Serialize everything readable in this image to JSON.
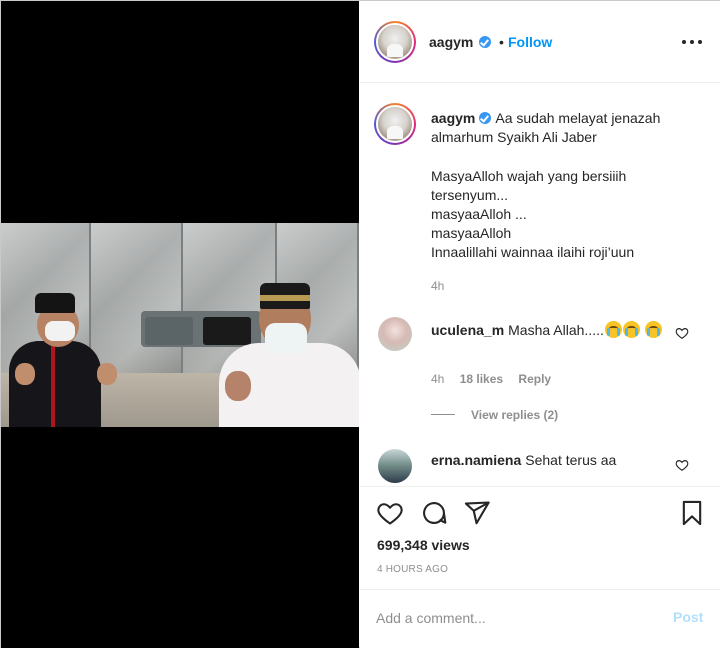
{
  "post": {
    "username": "aagym",
    "follow_label": "Follow",
    "dot": "•",
    "more_icon": "more-horizontal-icon"
  },
  "caption": {
    "username": "aagym",
    "first_line": "Aa sudah melayat jenazah almarhum Syaikh Ali Jaber",
    "body": "MasyaAlloh wajah yang bersiiih\ntersenyum...\nmasyaaAlloh ...\nmasyaaAlloh\nInnaalillahi wainnaa ilaihi roji’uun",
    "time": "4h"
  },
  "comments": [
    {
      "username": "uculena_m",
      "text": "Masha Allah.....",
      "emoji_count": 3,
      "time": "4h",
      "likes": "18 likes",
      "reply_label": "Reply",
      "view_replies": "View replies (2)"
    },
    {
      "username": "erna.namiena",
      "text": "Sehat terus aa"
    }
  ],
  "actions": {
    "icons": [
      "heart-icon",
      "comment-icon",
      "share-icon",
      "save-icon"
    ],
    "views": "699,348 views",
    "posted_ago": "4 HOURS AGO"
  },
  "add_comment": {
    "placeholder": "Add a comment...",
    "post_label": "Post"
  },
  "colors": {
    "accent": "#0095f6",
    "text": "#262626",
    "muted": "#8e8e8e",
    "post_disabled": "#b2dffc",
    "border": "#efefef"
  }
}
